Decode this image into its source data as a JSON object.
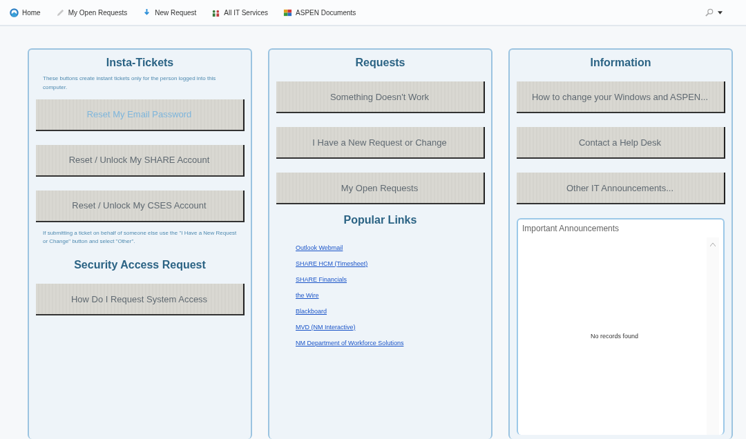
{
  "nav": {
    "items": [
      {
        "label": "Home"
      },
      {
        "label": "My Open Requests"
      },
      {
        "label": "New Request"
      },
      {
        "label": "All IT Services"
      },
      {
        "label": "ASPEN Documents"
      }
    ]
  },
  "panels": [
    {
      "sections": [
        {
          "kind": "heading",
          "text": "Insta-Tickets"
        },
        {
          "kind": "note",
          "text": "These buttons create instant tickets only for the person logged into this computer."
        },
        {
          "kind": "button",
          "text": "Reset My Email Password",
          "disabled": true
        },
        {
          "kind": "button",
          "text": "Reset / Unlock My SHARE Account",
          "disabled": false
        },
        {
          "kind": "button",
          "text": "Reset / Unlock My CSES Account",
          "disabled": false
        },
        {
          "kind": "note",
          "text": "If submitting a ticket on behalf of someone else use the \"I Have a New Request or Change\" button and select \"Other\"."
        },
        {
          "kind": "heading",
          "text": "Security Access Request"
        },
        {
          "kind": "button",
          "text": "How Do I Request System Access",
          "disabled": false
        }
      ]
    },
    {
      "sections": [
        {
          "kind": "heading",
          "text": "Requests"
        },
        {
          "kind": "button",
          "text": "Something Doesn't Work",
          "disabled": false
        },
        {
          "kind": "button",
          "text": "I Have a New Request or Change",
          "disabled": false
        },
        {
          "kind": "button",
          "text": "My Open Requests",
          "disabled": false
        },
        {
          "kind": "heading",
          "text": "Popular Links"
        },
        {
          "kind": "links",
          "items": [
            "Outlook Webmail",
            "SHARE HCM (Timesheet)",
            "SHARE Financials",
            "the Wire",
            "Blackboard",
            "MVD (NM Interactive)",
            "NM Department of Workforce Solutions"
          ]
        }
      ]
    },
    {
      "sections": [
        {
          "kind": "heading",
          "text": "Information"
        },
        {
          "kind": "button",
          "text": "How to change your Windows and ASPEN...",
          "disabled": false
        },
        {
          "kind": "button",
          "text": "Contact a Help Desk",
          "disabled": false
        },
        {
          "kind": "button",
          "text": "Other IT Announcements...",
          "disabled": false
        },
        {
          "kind": "list-box",
          "title": "Important Announcements",
          "empty_text": "No records found"
        }
      ]
    }
  ]
}
